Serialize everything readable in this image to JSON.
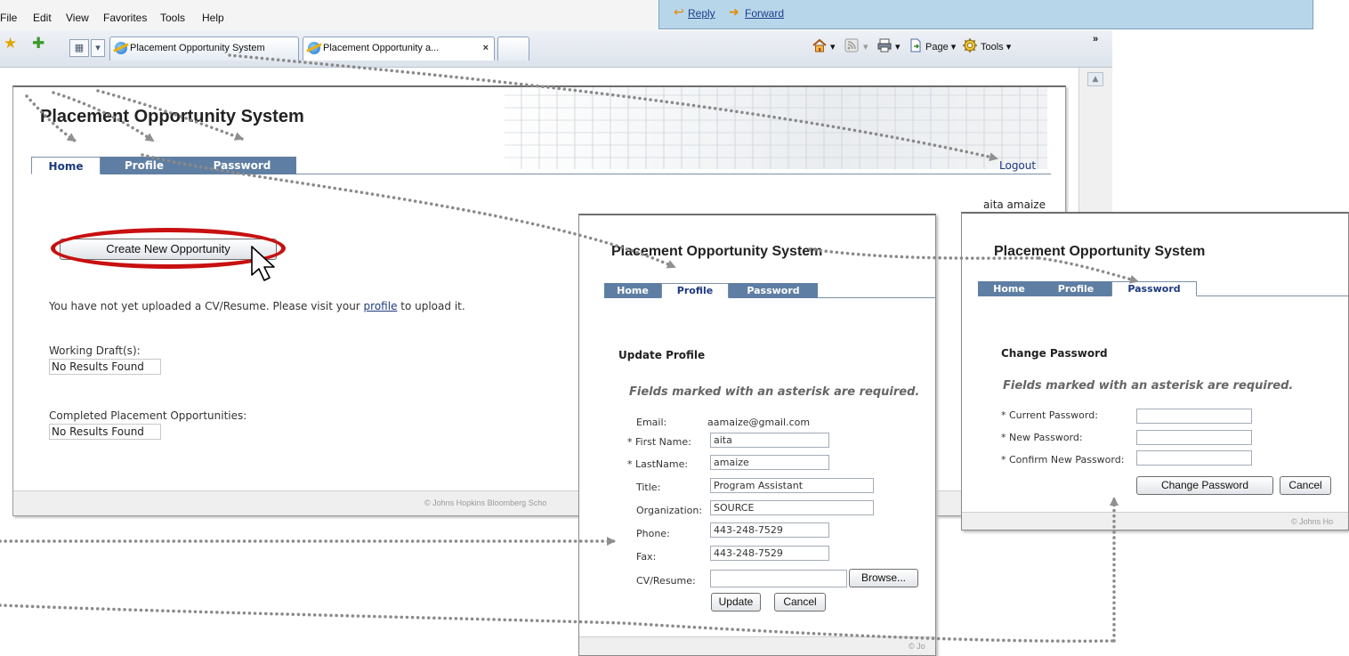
{
  "browser": {
    "menu": [
      "File",
      "Edit",
      "View",
      "Favorites",
      "Tools",
      "Help"
    ],
    "tabs": [
      {
        "label": "Placement Opportunity System"
      },
      {
        "label": "Placement Opportunity a..."
      }
    ],
    "tab_close": "×",
    "commands": {
      "page": "Page",
      "tools": "Tools",
      "more": "»"
    }
  },
  "mail": {
    "reply": "Reply",
    "forward": "Forward"
  },
  "main": {
    "title": "Placement Opportunity System",
    "nav": [
      "Home",
      "Profile",
      "Password"
    ],
    "logout": "Logout",
    "user": "aita amaize",
    "create_button": "Create New Opportunity",
    "cv_message_pre": "You have not yet uploaded a CV/Resume. Please visit your ",
    "cv_message_link": "profile",
    "cv_message_post": " to upload it.",
    "drafts_label": "Working Draft(s):",
    "drafts_empty": "No Results Found",
    "completed_label": "Completed Placement Opportunities:",
    "completed_empty": "No Results Found",
    "footer": "© Johns Hopkins Bloomberg Scho"
  },
  "profile": {
    "title": "Placement Opportunity System",
    "nav": [
      "Home",
      "Profile",
      "Password"
    ],
    "heading": "Update Profile",
    "required_note": "Fields marked with an asterisk are required.",
    "email_label": "Email:",
    "email_value": "aamaize@gmail.com",
    "fields": [
      {
        "label": "* First Name:",
        "value": "aita"
      },
      {
        "label": "* LastName:",
        "value": "amaize"
      },
      {
        "label": "Title:",
        "value": "Program Assistant"
      },
      {
        "label": "Organization:",
        "value": "SOURCE"
      },
      {
        "label": "Phone:",
        "value": "443-248-7529"
      },
      {
        "label": "Fax:",
        "value": "443-248-7529"
      }
    ],
    "cv_label": "CV/Resume:",
    "cv_value": "",
    "browse_button": "Browse...",
    "update_button": "Update",
    "cancel_button": "Cancel",
    "footer": "© Jo"
  },
  "password": {
    "title": "Placement Opportunity System",
    "nav": [
      "Home",
      "Profile",
      "Password"
    ],
    "heading": "Change Password",
    "required_note": "Fields marked with an asterisk are required.",
    "fields": [
      {
        "label": "* Current Password:",
        "value": ""
      },
      {
        "label": "* New Password:",
        "value": ""
      },
      {
        "label": "* Confirm New Password:",
        "value": ""
      }
    ],
    "change_button": "Change Password",
    "cancel_button": "Cancel",
    "footer": "© Johns Ho"
  },
  "colors": {
    "nav_bg": "#5f7ea3",
    "highlight": "#c81010",
    "link": "#1d3a80"
  }
}
